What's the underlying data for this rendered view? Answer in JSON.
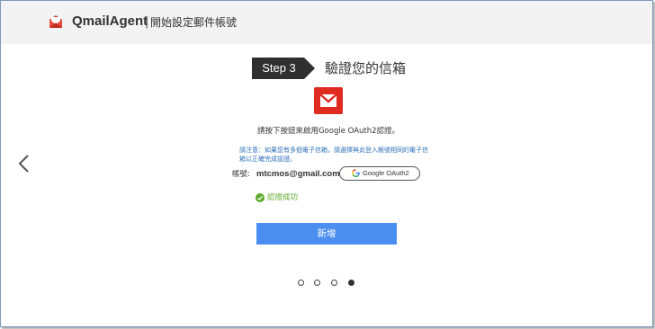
{
  "header": {
    "app_name": "QmailAgent",
    "separator": "|",
    "subtitle": "開始設定郵件帳號",
    "logo_icon": "envelope-icon"
  },
  "wizard": {
    "step_label": "Step 3",
    "step_title": "驗證您的信箱",
    "provider_icon": "gmail-icon",
    "instruction": "請按下按鈕來啟用Google OAuth2認證。",
    "note": "請注意：如果您有多個電子信箱，請選擇與此登入帳號相同的電子信箱以正確完成認證。",
    "account_label": "帳號:",
    "account_email": "mtcmos@gmail.com",
    "oauth_button_label": "Google OAuth2",
    "status_text": "認證成功",
    "add_button_label": "新增"
  },
  "navigation": {
    "prev_icon": "chevron-left-icon",
    "total_steps": 4,
    "current_step": 4
  },
  "colors": {
    "header_bg": "#f3f3f3",
    "step_badge": "#2f2f2f",
    "gmail_red": "#e02b21",
    "note_text": "#2c6fb8",
    "success": "#5aaa2a",
    "primary_button": "#4a8ef0"
  }
}
